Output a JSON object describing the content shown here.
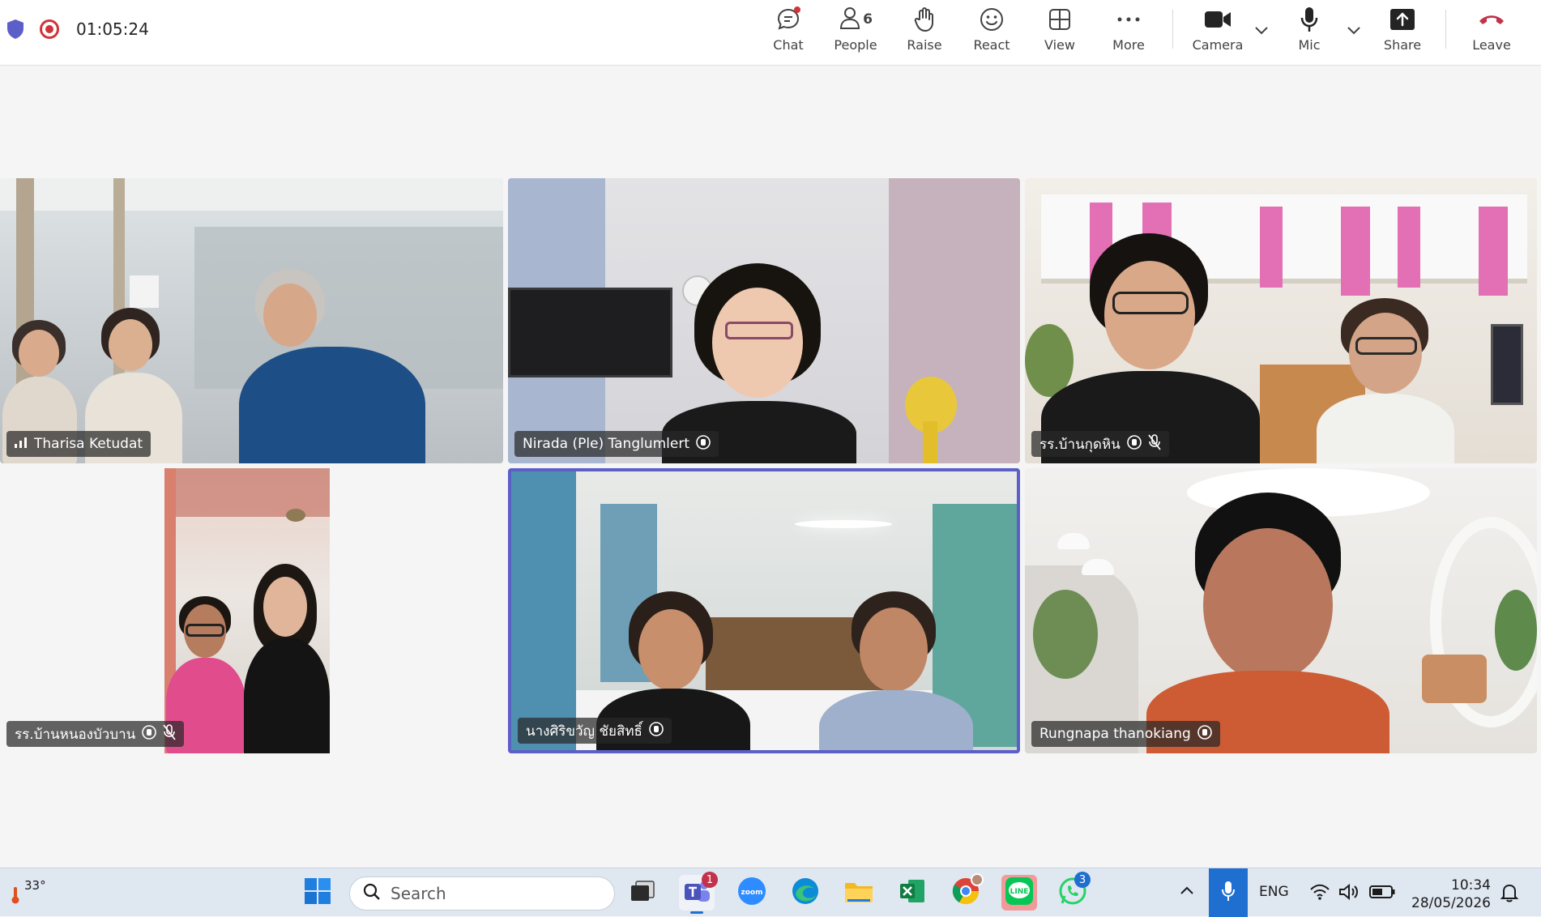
{
  "call": {
    "timer": "01:05:24"
  },
  "toolbar": {
    "chat": "Chat",
    "people": "People",
    "people_count": "6",
    "raise": "Raise",
    "react": "React",
    "view": "View",
    "more": "More",
    "camera": "Camera",
    "mic": "Mic",
    "share": "Share",
    "leave": "Leave",
    "leave_color": "#c4314b"
  },
  "tiles": [
    {
      "name": "Tharisa Ketudat",
      "indicator": "signal-bars-icon"
    },
    {
      "name": "Nirada (Ple) Tanglumlert",
      "indicator": "hand-icon"
    },
    {
      "name": "รร.บ้านกุดหิน",
      "indicator": "hand-icon",
      "muted": true
    },
    {
      "name": "รร.บ้านหนองบัวบาน",
      "indicator": "hand-icon",
      "muted": true
    },
    {
      "name": "นางศิริขวัญ ชัยสิทธิ์",
      "indicator": "hand-icon",
      "active_speaker": true
    },
    {
      "name": "Rungnapa thanokiang",
      "indicator": "hand-icon"
    }
  ],
  "taskbar": {
    "weather_temp": "33°",
    "search_placeholder": "Search",
    "teams_badge": "1",
    "whatsapp_badge": "3",
    "language": "ENG",
    "time": "10:34",
    "date": "28/05/2026"
  }
}
